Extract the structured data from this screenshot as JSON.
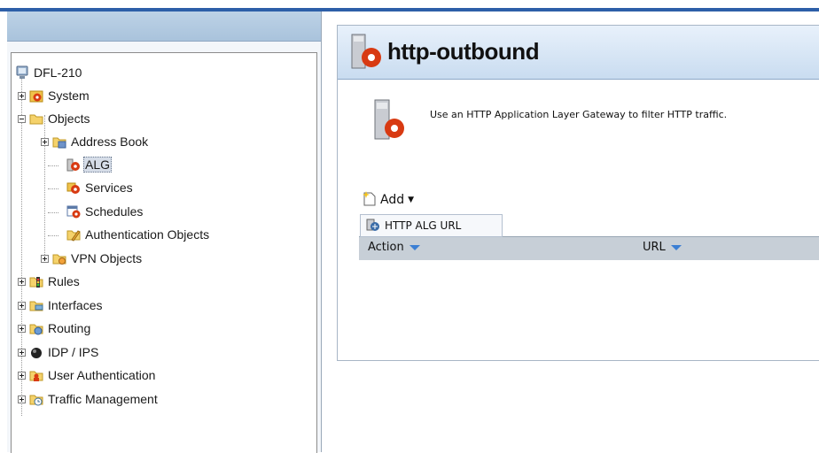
{
  "tree": {
    "root": "DFL-210",
    "items": [
      {
        "label": "System",
        "icon": "gear-icon"
      },
      {
        "label": "Objects",
        "icon": "folder-icon"
      },
      {
        "label": "Address Book",
        "icon": "address-book-icon"
      },
      {
        "label": "ALG",
        "icon": "alg-icon"
      },
      {
        "label": "Services",
        "icon": "services-icon"
      },
      {
        "label": "Schedules",
        "icon": "schedule-icon"
      },
      {
        "label": "Authentication Objects",
        "icon": "auth-icon"
      },
      {
        "label": "VPN Objects",
        "icon": "vpn-folder-icon"
      },
      {
        "label": "Rules",
        "icon": "rules-icon"
      },
      {
        "label": "Interfaces",
        "icon": "interfaces-icon"
      },
      {
        "label": "Routing",
        "icon": "routing-icon"
      },
      {
        "label": "IDP / IPS",
        "icon": "idp-icon"
      },
      {
        "label": "User Authentication",
        "icon": "user-auth-icon"
      },
      {
        "label": "Traffic Management",
        "icon": "traffic-icon"
      }
    ],
    "selected": "ALG"
  },
  "content": {
    "title": "http-outbound",
    "description": "Use an HTTP Application Layer Gateway to filter HTTP traffic.",
    "add_label": "Add",
    "add_menu_item": "HTTP ALG URL",
    "columns": [
      "Action",
      "URL"
    ]
  },
  "colors": {
    "accent": "#2d5fa8",
    "sort_arrow": "#3b7fd4",
    "gear_red": "#d83a12"
  }
}
